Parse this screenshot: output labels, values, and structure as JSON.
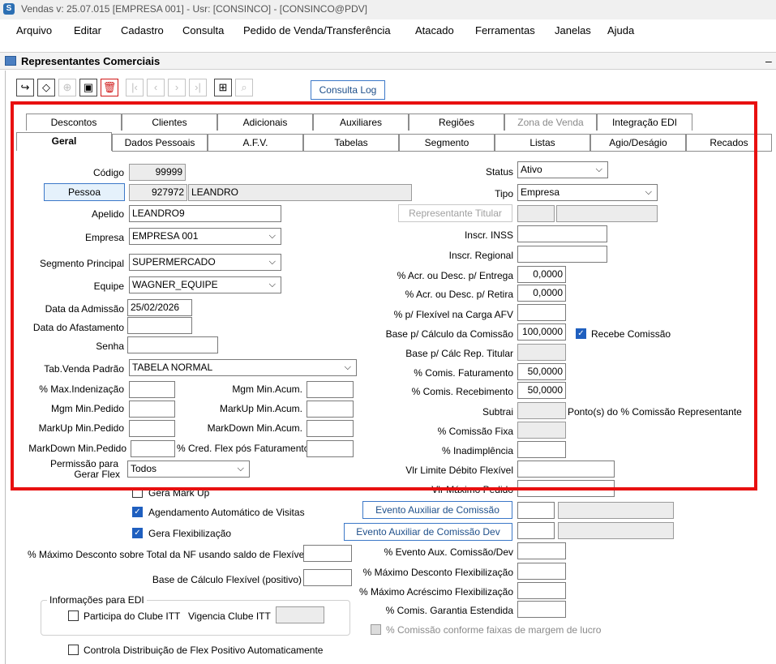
{
  "window": {
    "title": "Vendas  v: 25.07.015   [EMPRESA 001] - Usr: [CONSINCO] - [CONSINCO@PDV]"
  },
  "menu": [
    "Arquivo",
    "Editar",
    "Cadastro",
    "Consulta",
    "Pedido de Venda/Transferência",
    "Atacado",
    "Ferramentas",
    "Janelas",
    "Ajuda"
  ],
  "panel": {
    "title": "Representantes Comerciais",
    "minimize": "–"
  },
  "toolbar": {
    "consulta_log": "Consulta Log",
    "icons": [
      "exit-icon",
      "eraser-icon",
      "add-icon",
      "save-icon",
      "delete-icon",
      "first-icon",
      "prev-icon",
      "next-icon",
      "last-icon",
      "grid-icon",
      "search-icon"
    ]
  },
  "tabs_row1": [
    "Descontos",
    "Clientes",
    "Adicionais",
    "Auxiliares",
    "Regiões",
    "Zona de Venda",
    "Integração EDI"
  ],
  "tabs_row2": [
    "Geral",
    "Dados Pessoais",
    "A.F.V.",
    "Tabelas",
    "Segmento",
    "Listas",
    "Agio/Deságio",
    "Recados"
  ],
  "form": {
    "codigo_label": "Código",
    "codigo": "99999",
    "pessoa_btn": "Pessoa",
    "pessoa_id": "927972",
    "pessoa_nome": "LEANDRO",
    "apelido_label": "Apelido",
    "apelido": "LEANDRO9",
    "empresa_label": "Empresa",
    "empresa": "EMPRESA 001",
    "segmento_label": "Segmento Principal",
    "segmento": "SUPERMERCADO",
    "equipe_label": "Equipe",
    "equipe": "WAGNER_EQUIPE",
    "admissao_label": "Data da Admissão",
    "admissao": "25/02/2026",
    "afastamento_label": "Data do Afastamento",
    "senha_label": "Senha",
    "tabvenda_label": "Tab.Venda Padrão",
    "tabvenda": "TABELA NORMAL",
    "max_indenizacao_label": "% Max.Indenização",
    "mgm_min_pedido_label": "Mgm Min.Pedido",
    "markup_min_pedido_label": "MarkUp Min.Pedido",
    "markdown_min_pedido_label": "MarkDown Min.Pedido",
    "mgm_min_acum_label": "Mgm Min.Acum.",
    "markup_min_acum_label": "MarkUp Min.Acum.",
    "markdown_min_acum_label": "MarkDown Min.Acum.",
    "cred_flex_label": "% Cred. Flex pós Faturamento",
    "permissao_label_1": "Permissão para",
    "permissao_label_2": "Gerar Flex",
    "permissao": "Todos",
    "status_label": "Status",
    "status": "Ativo",
    "tipo_label": "Tipo",
    "tipo": "Empresa",
    "rep_titular_btn": "Representante Titular",
    "inscr_inss_label": "Inscr. INSS",
    "inscr_regional_label": "Inscr. Regional",
    "acr_entrega_label": "% Acr. ou Desc. p/ Entrega",
    "acr_entrega": "0,0000",
    "acr_retira_label": "% Acr. ou Desc. p/ Retira",
    "acr_retira": "0,0000",
    "flex_carga_label": "% p/ Flexível na Carga AFV",
    "base_comissao_label": "Base p/ Cálculo da Comissão",
    "base_comissao": "100,0000",
    "recebe_comissao_label": "Recebe Comissão",
    "base_rep_titular_label": "Base p/ Cálc Rep. Titular",
    "comis_faturamento_label": "% Comis. Faturamento",
    "comis_faturamento": "50,0000",
    "comis_recebimento_label": "% Comis. Recebimento",
    "comis_recebimento": "50,0000",
    "subtrai_label": "Subtrai",
    "subtrai_suffix": "Ponto(s) do % Comissão Representante",
    "comissao_fixa_label": "% Comissão Fixa",
    "inadimplencia_label": "% Inadimplência",
    "vlr_limite_label": "Vlr Limite Débito Flexível",
    "vlr_maximo_label": "Vlr Máximo Pedido",
    "gera_markup_label": "Gera Mark Up",
    "agendamento_label": "Agendamento Automático de Visitas",
    "gera_flex_label": "Gera Flexibilização",
    "evento_aux_btn": "Evento Auxiliar de Comissão",
    "evento_aux_dev_btn": "Evento Auxiliar de Comissão Dev",
    "max_desc_nf_label": "% Máximo Desconto sobre Total da NF usando saldo de Flexível",
    "base_flex_label": "Base de Cálculo Flexível (positivo)",
    "evento_aux_comdev_label": "% Evento Aux. Comissão/Dev",
    "max_desc_flex_label": "% Máximo Desconto Flexibilização",
    "max_acr_flex_label": "% Máximo Acréscimo Flexibilização",
    "comis_garantia_label": "% Comis. Garantia Estendida",
    "comissao_faixas_label": "% Comissão conforme faixas de margem de lucro",
    "edi_group_label": "Informações para EDI",
    "clube_itt_label": "Participa do Clube ITT",
    "vigencia_label": "Vigencia Clube ITT",
    "controla_flex_label": "Controla Distribuição de Flex Positivo Automaticamente"
  },
  "colors": {
    "highlight": "#e81010",
    "accent": "#3c78c8",
    "check": "#1f5fbf"
  }
}
